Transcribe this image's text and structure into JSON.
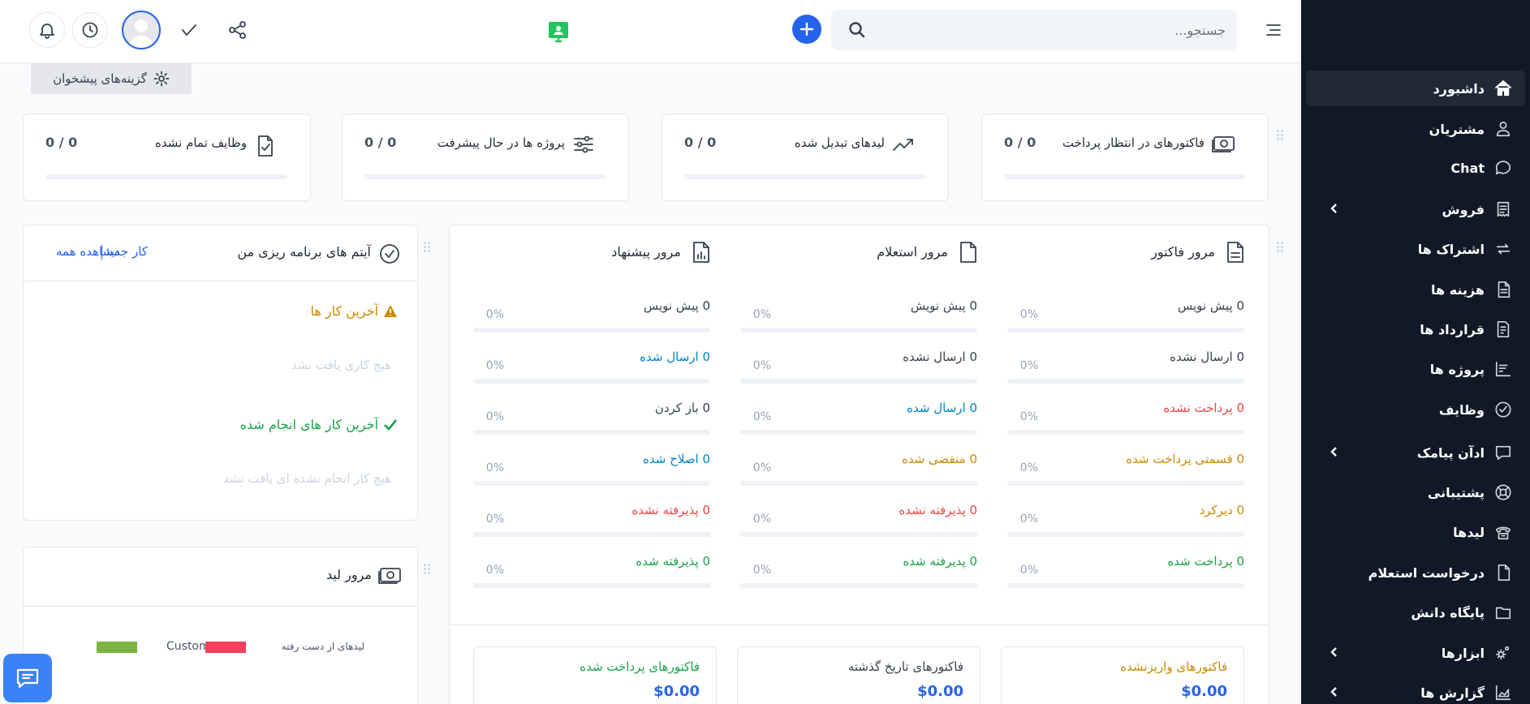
{
  "colors": {
    "sidebar_bg": "#111827",
    "accent_blue": "#2563eb",
    "green": "#16a34a",
    "red": "#ef4444",
    "orange": "#ca8a04",
    "brand_green": "#22c55e"
  },
  "sidebar": {
    "items": [
      {
        "label": "داشبورد",
        "icon": "home-icon",
        "active": true,
        "has_children": false
      },
      {
        "label": "مشتریان",
        "icon": "user-icon",
        "has_children": false
      },
      {
        "label": "Chat",
        "icon": "chat-bubble-icon",
        "has_children": false
      },
      {
        "label": "فروش",
        "icon": "receipt-icon",
        "has_children": true
      },
      {
        "label": "اشتراک ها",
        "icon": "repeat-icon",
        "has_children": false
      },
      {
        "label": "هزینه ها",
        "icon": "file-text-icon",
        "has_children": false
      },
      {
        "label": "قرارداد ها",
        "icon": "contract-icon",
        "has_children": false
      },
      {
        "label": "پروژه ها",
        "icon": "chart-bars-icon",
        "has_children": false
      },
      {
        "label": "وظایف",
        "icon": "check-circle-icon",
        "has_children": false
      },
      {
        "label": "ادآن پیامک",
        "icon": "message-icon",
        "has_children": true
      },
      {
        "label": "پشتیبانی",
        "icon": "lifebuoy-icon",
        "has_children": false
      },
      {
        "label": "لیدها",
        "icon": "phone-icon",
        "has_children": false
      },
      {
        "label": "درخواست استعلام",
        "icon": "file-icon",
        "has_children": false
      },
      {
        "label": "پایگاه دانش",
        "icon": "folder-icon",
        "has_children": false
      },
      {
        "label": "ابزارها",
        "icon": "cogs-icon",
        "has_children": true
      },
      {
        "label": "گزارش ها",
        "icon": "chart-area-icon",
        "has_children": true
      }
    ]
  },
  "topbar": {
    "search_placeholder": "جستجو..."
  },
  "dashboard_options": {
    "label": "گزینه‌های پیشخوان"
  },
  "stats": [
    {
      "title": "فاکتورهای در انتظار پرداخت",
      "value": "0 / 0",
      "icon": "money-icon"
    },
    {
      "title": "لیدهای تبدیل شده",
      "value": "0 / 0",
      "icon": "trending-up-icon"
    },
    {
      "title": "پروژه ها در حال پیشرفت",
      "value": "0 / 0",
      "icon": "sliders-icon"
    },
    {
      "title": "وظایف تمام نشده",
      "value": "0 / 0",
      "icon": "file-check-icon"
    }
  ],
  "overviews": [
    {
      "title": "مرور فاکتور",
      "rows": [
        {
          "label": "0 پیش نویس",
          "pct": "0%",
          "color": "#374151"
        },
        {
          "label": "0 ارسال نشده",
          "pct": "0%",
          "color": "#374151"
        },
        {
          "label": "0 پرداخت نشده",
          "pct": "0%",
          "color": "#ef4444"
        },
        {
          "label": "0 قسمتی پرداخت شده",
          "pct": "0%",
          "color": "#ca8a04"
        },
        {
          "label": "0 دیرکرد",
          "pct": "0%",
          "color": "#ca8a04"
        },
        {
          "label": "0 پرداخت شده",
          "pct": "0%",
          "color": "#16a34a"
        }
      ]
    },
    {
      "title": "مرور استعلام",
      "rows": [
        {
          "label": "0 پیش نویش",
          "pct": "0%",
          "color": "#374151"
        },
        {
          "label": "0 ارسال نشده",
          "pct": "0%",
          "color": "#374151"
        },
        {
          "label": "0 ارسال شده",
          "pct": "0%",
          "color": "#0284c7"
        },
        {
          "label": "0 منقضی شده",
          "pct": "0%",
          "color": "#ca8a04"
        },
        {
          "label": "0 پذیرفته نشده",
          "pct": "0%",
          "color": "#ef4444"
        },
        {
          "label": "0 پدیرفته شده",
          "pct": "0%",
          "color": "#16a34a"
        }
      ]
    },
    {
      "title": "مرور پیشنهاد",
      "rows": [
        {
          "label": "0 پیش نویس",
          "pct": "0%",
          "color": "#374151"
        },
        {
          "label": "0 ارسال شده",
          "pct": "0%",
          "color": "#0284c7"
        },
        {
          "label": "0 باز کردن",
          "pct": "0%",
          "color": "#374151"
        },
        {
          "label": "0 اصلاح شده",
          "pct": "0%",
          "color": "#0284c7"
        },
        {
          "label": "0 پذیرفته نشده",
          "pct": "0%",
          "color": "#ef4444"
        },
        {
          "label": "0 پذیرفته شده",
          "pct": "0%",
          "color": "#16a34a"
        }
      ]
    }
  ],
  "summary": [
    {
      "title": "فاکتورهای واریزنشده",
      "value": "$0.00",
      "color": "#ca8a04"
    },
    {
      "title": "فاکتورهای تاریخ گذشته",
      "value": "$0.00",
      "color": "#374151"
    },
    {
      "title": "فاکتورهای پرداخت شده",
      "value": "$0.00",
      "color": "#16a34a"
    }
  ],
  "planning": {
    "title": "آیتم های برنامه ریزی من",
    "new_task": "کار جدید",
    "view_all": "مشاهده همه",
    "latest_tasks": "آخرین کار ها",
    "no_tasks": "هیچ کاری یافت نشد",
    "latest_done": "آخرین کار های انجام شده",
    "no_done": "هیچ کار انجام نشده ای یافت نشد"
  },
  "leads_overview": {
    "title": "مرور لید",
    "legend": [
      {
        "name": "لیدهای از دست رفته",
        "color": "#f43f5e"
      },
      {
        "name": "Customer",
        "color": "#7cb342"
      }
    ]
  }
}
